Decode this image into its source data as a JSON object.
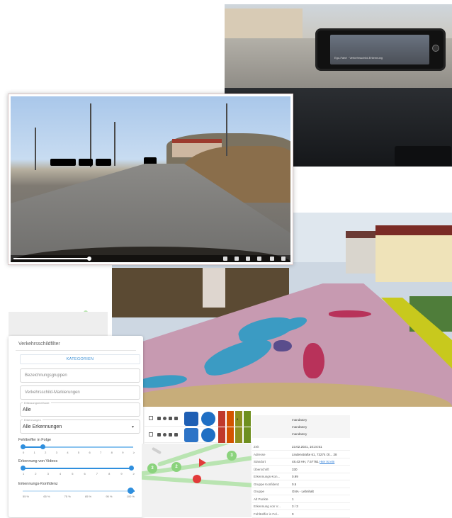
{
  "car_photo": {
    "phone_caption": "Ego-Fahrt · Verkehrsschild-Erkennung"
  },
  "video_player": {
    "progress_fraction": 0.27
  },
  "filter": {
    "title": "Verkehrsschildfilter",
    "tab_label": "KATEGORIEN",
    "field_groups_placeholder": "Bezeichnungsgruppen",
    "field_markings_placeholder": "Verkehrsschild-Markierungen",
    "method_legend": "Erfassungsmethode",
    "method_value": "Alle",
    "detections_legend": "Erkennungen",
    "detections_value": "Alle Erkennungen",
    "slider1_label": "Fehltreffer in Folge",
    "slider1_ticks": [
      "0",
      "1",
      "2",
      "3",
      "4",
      "5",
      "6",
      "7",
      "8",
      "9",
      "≥"
    ],
    "slider2_label": "Erkennung von Videos",
    "slider2_ticks": [
      "1",
      "2",
      "3",
      "4",
      "5",
      "6",
      "7",
      "8",
      "9",
      "≥"
    ],
    "slider3_label": "Erkennungs-Konfidenz",
    "slider3_ticks": [
      "55 %",
      "65 %",
      "75 %",
      "85 %",
      "95 %",
      "100 %"
    ]
  },
  "map": {
    "nodes": [
      "3",
      "2",
      "3"
    ]
  },
  "sign_table": {
    "rows": [
      {
        "heat_values": [
          "",
          "",
          "8",
          "",
          "",
          "43",
          "45"
        ]
      },
      {
        "heat_values": [
          "",
          "",
          "",
          "",
          "",
          "48",
          ""
        ]
      }
    ]
  },
  "detail": {
    "top_values": [
      "mandatory",
      "mandatory",
      "mandatory"
    ],
    "rows": [
      {
        "key": "Zeit",
        "value": "23.02.2021, 10:24:51"
      },
      {
        "key": "Adresse",
        "value": "Lindenstraße 61, 73274 Ot... 28"
      },
      {
        "key": "Standort",
        "value": "48.43 HH, 7.5?761",
        "link": "Hier ist ein"
      },
      {
        "key": "Überschrift",
        "value": "330"
      },
      {
        "key": "Erkennungs-Kon...",
        "value": "0.99"
      },
      {
        "key": "Gruppe Konfidenz",
        "value": "0.5"
      },
      {
        "key": "Gruppe",
        "value": "GNA - Lebnhalt"
      },
      {
        "key": "Alt Punkte",
        "value": "1"
      },
      {
        "key": "Erkennung von V...",
        "value": "3 / 3"
      },
      {
        "key": "Fehltreffer in Fol...",
        "value": "0"
      }
    ]
  },
  "colors": {
    "accent": "#2f8fde",
    "seg_road": "#c79ab1",
    "seg_crack_blue": "#3b9bc3",
    "seg_crack_red": "#b8325a",
    "seg_curb": "#c8c91d"
  }
}
